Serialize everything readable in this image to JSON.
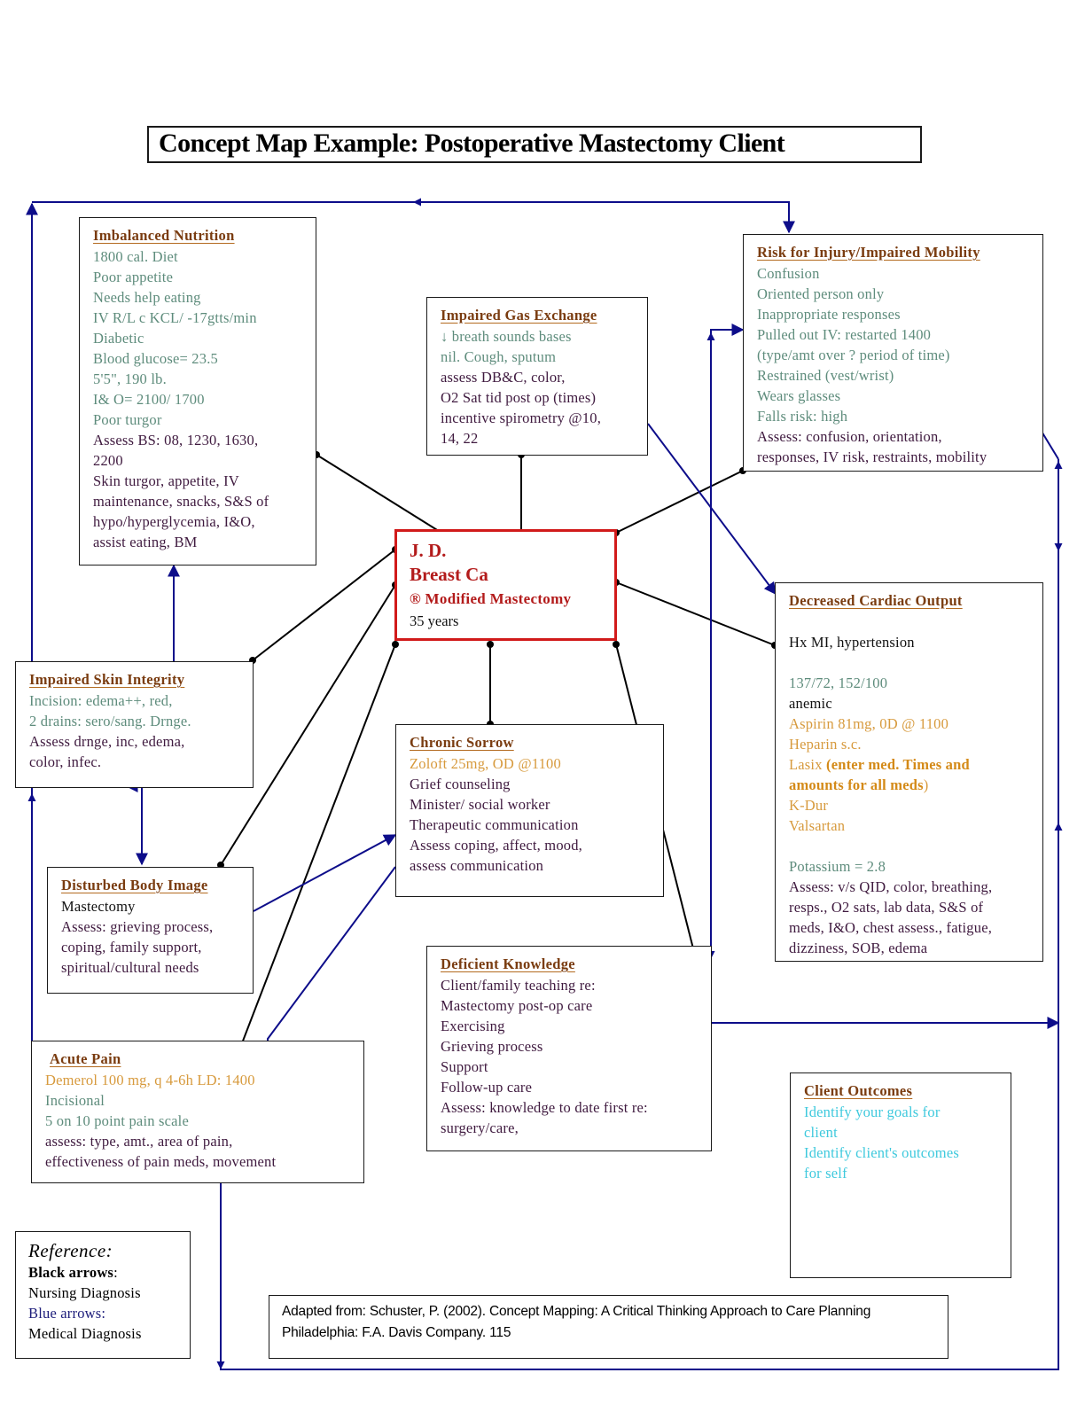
{
  "title": "Concept Map Example: Postoperative Mastectomy Client",
  "colors": {
    "nursing_arrow": "#000000",
    "medical_arrow": "#0d0d8a",
    "center_border": "#d11a1a",
    "heading": "#7a3c10"
  },
  "center": {
    "name": "J. D.",
    "diagnosis": "Breast Ca",
    "procedure": "® Modified Mastectomy",
    "age": "35 years"
  },
  "boxes": {
    "imbalanced_nutrition": {
      "title": "Imbalanced Nutrition",
      "lines": [
        {
          "text": "1800 cal. Diet",
          "style": "teal"
        },
        {
          "text": "Poor appetite",
          "style": "teal"
        },
        {
          "text": "Needs help eating",
          "style": "teal"
        },
        {
          "text": "IV R/L c KCL/ -17gtts/min",
          "style": "teal"
        },
        {
          "text": "Diabetic",
          "style": "teal"
        },
        {
          "text": "Blood glucose= 23.5",
          "style": "teal"
        },
        {
          "text": "5'5\", 190 lb.",
          "style": "teal"
        },
        {
          "text": "I& O= 2100/ 1700",
          "style": "teal"
        },
        {
          "text": "Poor turgor",
          "style": "teal"
        },
        {
          "text": "Assess BS: 08, 1230, 1630,",
          "style": "purple"
        },
        {
          "text": "2200",
          "style": "purple"
        },
        {
          "text": "Skin turgor, appetite, IV",
          "style": "purple"
        },
        {
          "text": "maintenance, snacks, S&S of",
          "style": "purple"
        },
        {
          "text": "hypo/hyperglycemia, I&O,",
          "style": "purple"
        },
        {
          "text": "assist eating, BM",
          "style": "purple"
        }
      ]
    },
    "impaired_gas_exchange": {
      "title": "Impaired Gas Exchange",
      "lines": [
        {
          "text": "↓ breath sounds bases",
          "style": "teal"
        },
        {
          "text": "nil. Cough, sputum",
          "style": "teal"
        },
        {
          "text": "assess DB&C, color,",
          "style": "purple"
        },
        {
          "text": "O2 Sat tid post op (times)",
          "style": "purple"
        },
        {
          "text": "incentive spirometry @10,",
          "style": "purple"
        },
        {
          "text": "14, 22",
          "style": "purple"
        }
      ]
    },
    "risk_for_injury": {
      "title": "Risk for Injury/Impaired Mobility",
      "lines": [
        {
          "text": "Confusion",
          "style": "teal"
        },
        {
          "text": "Oriented person only",
          "style": "teal"
        },
        {
          "text": "Inappropriate responses",
          "style": "teal"
        },
        {
          "text": "Pulled out IV: restarted 1400",
          "style": "teal"
        },
        {
          "text": "(type/amt over ? period of time)",
          "style": "teal"
        },
        {
          "text": "Restrained (vest/wrist)",
          "style": "teal"
        },
        {
          "text": "Wears glasses",
          "style": "teal"
        },
        {
          "text": "Falls risk: high",
          "style": "teal"
        },
        {
          "text": "Assess: confusion, orientation,",
          "style": "purple"
        },
        {
          "text": "responses, IV risk, restraints, mobility",
          "style": "purple"
        }
      ]
    },
    "decreased_cardiac_output": {
      "title": "Decreased Cardiac Output",
      "lines": [
        {
          "text": "",
          "style": "black"
        },
        {
          "text": "Hx MI, hypertension",
          "style": "black"
        },
        {
          "text": "",
          "style": "black"
        },
        {
          "text": "137/72, 152/100",
          "style": "teal"
        },
        {
          "text": "anemic",
          "style": "black"
        },
        {
          "text": "Aspirin 81mg, 0D @ 1100",
          "style": "orange"
        },
        {
          "text": "Heparin s.c.",
          "style": "orange"
        },
        {
          "text": "Lasix",
          "style": "orange",
          "suffix": " (enter med. Times and",
          "suffix_style": "orange-bold"
        },
        {
          "text": "amounts for all meds",
          "style": "orange-bold",
          "suffix": ")",
          "suffix_style": "orange"
        },
        {
          "text": "K-Dur",
          "style": "orange"
        },
        {
          "text": "Valsartan",
          "style": "orange"
        },
        {
          "text": "",
          "style": "black"
        },
        {
          "text": "Potassium = 2.8",
          "style": "teal"
        },
        {
          "text": "Assess: v/s QID, color, breathing,",
          "style": "purple"
        },
        {
          "text": "resps., O2 sats, lab data, S&S of",
          "style": "purple"
        },
        {
          "text": "meds, I&O, chest assess., fatigue,",
          "style": "purple"
        },
        {
          "text": "dizziness, SOB, edema",
          "style": "purple"
        }
      ]
    },
    "impaired_skin_integrity": {
      "title": "Impaired Skin Integrity",
      "lines": [
        {
          "text": "Incision: edema++, red,",
          "style": "teal"
        },
        {
          "text": "2 drains: sero/sang. Drnge.",
          "style": "teal"
        },
        {
          "text": "Assess drnge, inc, edema,",
          "style": "purple"
        },
        {
          "text": "color, infec.",
          "style": "purple"
        }
      ]
    },
    "chronic_sorrow": {
      "title": "Chronic Sorrow",
      "lines": [
        {
          "text": "Zoloft 25mg, OD @1100",
          "style": "orange"
        },
        {
          "text": "Grief counseling",
          "style": "purple"
        },
        {
          "text": "Minister/ social worker",
          "style": "purple"
        },
        {
          "text": "Therapeutic communication",
          "style": "purple"
        },
        {
          "text": "Assess coping, affect, mood,",
          "style": "purple"
        },
        {
          "text": "assess communication",
          "style": "purple"
        }
      ]
    },
    "disturbed_body_image": {
      "title": "Disturbed Body Image",
      "lines": [
        {
          "text": "Mastectomy",
          "style": "black"
        },
        {
          "text": "Assess: grieving process,",
          "style": "purple"
        },
        {
          "text": "coping, family support,",
          "style": "purple"
        },
        {
          "text": "spiritual/cultural needs",
          "style": "purple"
        }
      ]
    },
    "deficient_knowledge": {
      "title": "Deficient Knowledge",
      "lines": [
        {
          "text": "Client/family teaching re:",
          "style": "purple"
        },
        {
          "text": "Mastectomy post-op care",
          "style": "purple"
        },
        {
          "text": "Exercising",
          "style": "purple"
        },
        {
          "text": "Grieving process",
          "style": "purple"
        },
        {
          "text": "Support",
          "style": "purple"
        },
        {
          "text": "Follow-up care",
          "style": "purple"
        },
        {
          "text": "Assess: knowledge to date first re:",
          "style": "purple"
        },
        {
          "text": "surgery/care,",
          "style": "purple"
        }
      ]
    },
    "acute_pain": {
      "title": "Acute Pain",
      "lines": [
        {
          "text": "Demerol 100 mg, q 4-6h LD: 1400",
          "style": "orange"
        },
        {
          "text": "Incisional",
          "style": "teal"
        },
        {
          "text": "5 on 10 point pain scale",
          "style": "teal"
        },
        {
          "text": "assess: type, amt., area of pain,",
          "style": "purple"
        },
        {
          "text": "effectiveness of pain meds, movement",
          "style": "purple"
        }
      ]
    },
    "client_outcomes": {
      "title": "Client Outcomes",
      "lines": [
        {
          "text": "Identify your goals for",
          "style": "cyan"
        },
        {
          "text": "client",
          "style": "cyan"
        },
        {
          "text": "Identify client's outcomes",
          "style": "cyan"
        },
        {
          "text": "for self",
          "style": "cyan"
        }
      ]
    }
  },
  "reference": {
    "title": "Reference:",
    "black_label": "Black arrows",
    "black_colon": ":",
    "black_meaning": "Nursing Diagnosis",
    "blue_label": "Blue arrows:",
    "blue_meaning": "Medical Diagnosis"
  },
  "citation": {
    "line1": "Adapted from: Schuster, P. (2002). Concept Mapping: A Critical Thinking Approach to Care Planning",
    "line2": "Philadelphia: F.A. Davis Company.  115"
  },
  "connectors": {
    "nursing": [
      {
        "from": "center",
        "to": "imbalanced_nutrition"
      },
      {
        "from": "center",
        "to": "impaired_gas_exchange"
      },
      {
        "from": "center",
        "to": "risk_for_injury"
      },
      {
        "from": "center",
        "to": "decreased_cardiac_output"
      },
      {
        "from": "center",
        "to": "impaired_skin_integrity"
      },
      {
        "from": "center",
        "to": "disturbed_body_image"
      },
      {
        "from": "center",
        "to": "acute_pain"
      },
      {
        "from": "center",
        "to": "chronic_sorrow"
      },
      {
        "from": "center",
        "to": "deficient_knowledge"
      }
    ],
    "medical": [
      {
        "from": "imbalanced_nutrition",
        "to": "impaired_skin_integrity"
      },
      {
        "from": "impaired_skin_integrity",
        "to": "disturbed_body_image"
      },
      {
        "from": "disturbed_body_image",
        "to": "chronic_sorrow"
      },
      {
        "from": "chronic_sorrow",
        "to": "acute_pain"
      },
      {
        "from": "impaired_gas_exchange",
        "to": "decreased_cardiac_output"
      },
      {
        "from": "deficient_knowledge",
        "to": "risk_for_injury"
      },
      {
        "from": "acute_pain",
        "to": "risk_for_injury"
      },
      {
        "from": "impaired_skin_integrity",
        "to": "risk_for_injury"
      }
    ]
  }
}
